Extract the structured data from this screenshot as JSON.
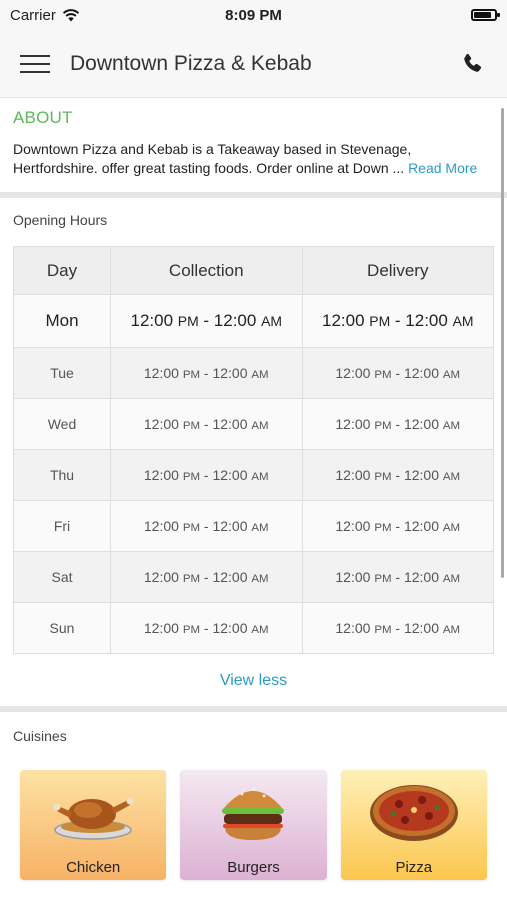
{
  "status_bar": {
    "carrier": "Carrier",
    "time": "8:09 PM",
    "battery_level": 0.85
  },
  "navbar": {
    "title": "Downtown Pizza & Kebab",
    "menu_icon": "hamburger-menu-icon",
    "phone_icon": "phone-icon"
  },
  "about": {
    "heading": "ABOUT",
    "text": "Downtown Pizza and Kebab is a Takeaway based in Stevenage, Hertfordshire. offer great tasting foods. Order online at Down ...",
    "read_more": "Read More"
  },
  "opening_hours": {
    "heading": "Opening Hours",
    "columns": [
      "Day",
      "Collection",
      "Delivery"
    ],
    "rows": [
      {
        "day": "Mon",
        "c_open": "12:00",
        "c_open_ampm": "PM",
        "c_close": "12:00",
        "c_close_ampm": "AM",
        "d_open": "12:00",
        "d_open_ampm": "PM",
        "d_close": "12:00",
        "d_close_ampm": "AM"
      },
      {
        "day": "Tue",
        "c_open": "12:00",
        "c_open_ampm": "PM",
        "c_close": "12:00",
        "c_close_ampm": "AM",
        "d_open": "12:00",
        "d_open_ampm": "PM",
        "d_close": "12:00",
        "d_close_ampm": "AM"
      },
      {
        "day": "Wed",
        "c_open": "12:00",
        "c_open_ampm": "PM",
        "c_close": "12:00",
        "c_close_ampm": "AM",
        "d_open": "12:00",
        "d_open_ampm": "PM",
        "d_close": "12:00",
        "d_close_ampm": "AM"
      },
      {
        "day": "Thu",
        "c_open": "12:00",
        "c_open_ampm": "PM",
        "c_close": "12:00",
        "c_close_ampm": "AM",
        "d_open": "12:00",
        "d_open_ampm": "PM",
        "d_close": "12:00",
        "d_close_ampm": "AM"
      },
      {
        "day": "Fri",
        "c_open": "12:00",
        "c_open_ampm": "PM",
        "c_close": "12:00",
        "c_close_ampm": "AM",
        "d_open": "12:00",
        "d_open_ampm": "PM",
        "d_close": "12:00",
        "d_close_ampm": "AM"
      },
      {
        "day": "Sat",
        "c_open": "12:00",
        "c_open_ampm": "PM",
        "c_close": "12:00",
        "c_close_ampm": "AM",
        "d_open": "12:00",
        "d_open_ampm": "PM",
        "d_close": "12:00",
        "d_close_ampm": "AM"
      },
      {
        "day": "Sun",
        "c_open": "12:00",
        "c_open_ampm": "PM",
        "c_close": "12:00",
        "c_close_ampm": "AM",
        "d_open": "12:00",
        "d_open_ampm": "PM",
        "d_close": "12:00",
        "d_close_ampm": "AM"
      }
    ],
    "view_less": "View less"
  },
  "cuisines": {
    "heading": "Cuisines",
    "items": [
      {
        "label": "Chicken",
        "icon": "roast-chicken-icon"
      },
      {
        "label": "Burgers",
        "icon": "burger-icon"
      },
      {
        "label": "Pizza",
        "icon": "pizza-icon"
      }
    ]
  },
  "colors": {
    "accent_green": "#5cb85c",
    "link_blue": "#2a9bc8"
  }
}
